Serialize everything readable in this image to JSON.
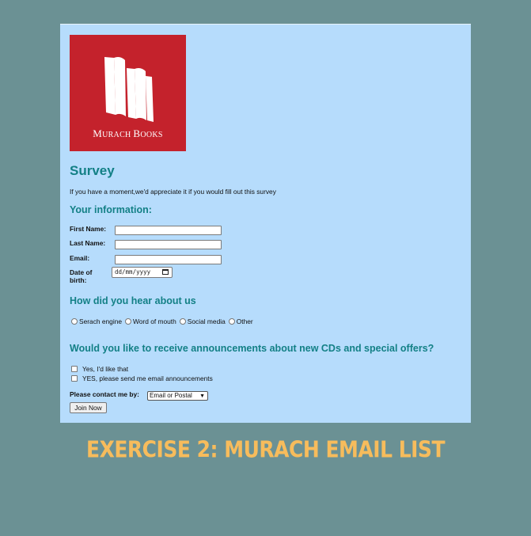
{
  "logo": {
    "name_first": "M",
    "name_rest": "URACH ",
    "name_second": "B",
    "name_second_rest": "OOKS"
  },
  "survey": {
    "title": "Survey",
    "intro": "If you have a moment,we'd appreciate it if you would fill out this survey"
  },
  "your_info": {
    "heading": "Your information:",
    "first_name_label": "First Name:",
    "last_name_label": "Last Name:",
    "email_label": "Email:",
    "dob_label": "Date of birth:",
    "dob_placeholder": "dd/mm/yyyy"
  },
  "hear_about": {
    "heading": "How did you hear about us",
    "options": [
      "Serach engine",
      "Word of mouth",
      "Social media",
      "Other"
    ]
  },
  "announcements": {
    "heading": "Would you like to receive announcements about new CDs and special offers?",
    "check1": "Yes, I'd like that",
    "check2": "YES, please send me email announcements"
  },
  "contact": {
    "label": "Please contact me by:",
    "selected": "Email or Postal"
  },
  "submit_label": "Join Now",
  "caption": "EXERCISE 2: MURACH EMAIL LIST",
  "colors": {
    "background": "#6b9194",
    "panel": "#b6dcfc",
    "heading": "#138086",
    "logo": "#c4222c",
    "caption": "#f7bc5c"
  }
}
